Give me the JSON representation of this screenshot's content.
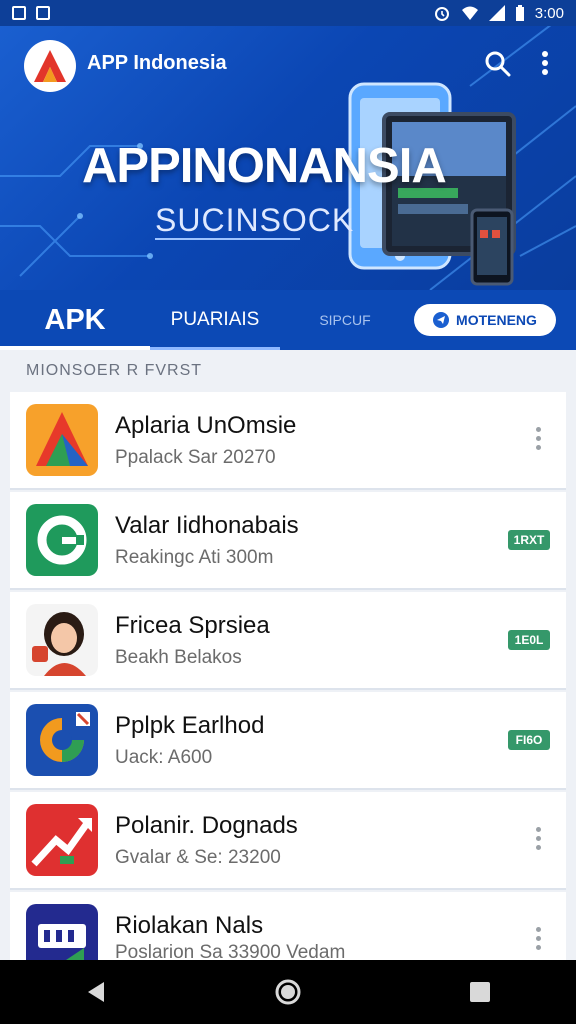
{
  "status_bar": {
    "time": "3:00",
    "icons": [
      "notification-icon",
      "alarm-icon",
      "wifi-icon",
      "battery-icon"
    ]
  },
  "header": {
    "app_title": "APP Indonesia",
    "icons": [
      "search-icon",
      "more-vert-icon"
    ]
  },
  "hero": {
    "heading": "APPINONANSIA",
    "subheading": "SUCINSOCK"
  },
  "tabs": [
    {
      "label": "APK",
      "active": true
    },
    {
      "label": "PUARIAIS",
      "active": false
    },
    {
      "label": "SIPCUF",
      "active": false
    }
  ],
  "tab_button": {
    "label": "MOTENENG"
  },
  "section": {
    "header": "MIONSOER R FVRST"
  },
  "apps": [
    {
      "title": "Aplaria UnOmsie",
      "subtitle": "Ppalack Sar 20270",
      "action": "menu"
    },
    {
      "title": "Valar Iidhonabais",
      "subtitle": "Reakingc Ati 300m",
      "action": "badge",
      "badge": "1RXT"
    },
    {
      "title": "Fricea Sprsiea",
      "subtitle": "Beakh Belakos",
      "action": "badge",
      "badge": "1E0L"
    },
    {
      "title": "Pplpk Earlhod",
      "subtitle": "Uack: A600",
      "action": "badge",
      "badge": "FI6O"
    },
    {
      "title": "Polanir. Dognads",
      "subtitle": "Gvalar & Se: 23200",
      "action": "menu"
    },
    {
      "title": "Riolakan Nals",
      "subtitle": "Poslarion Sa 33900 Vedam",
      "action": "menu"
    }
  ],
  "colors": {
    "primary": "#0c49b5",
    "badge": "#35986a"
  }
}
